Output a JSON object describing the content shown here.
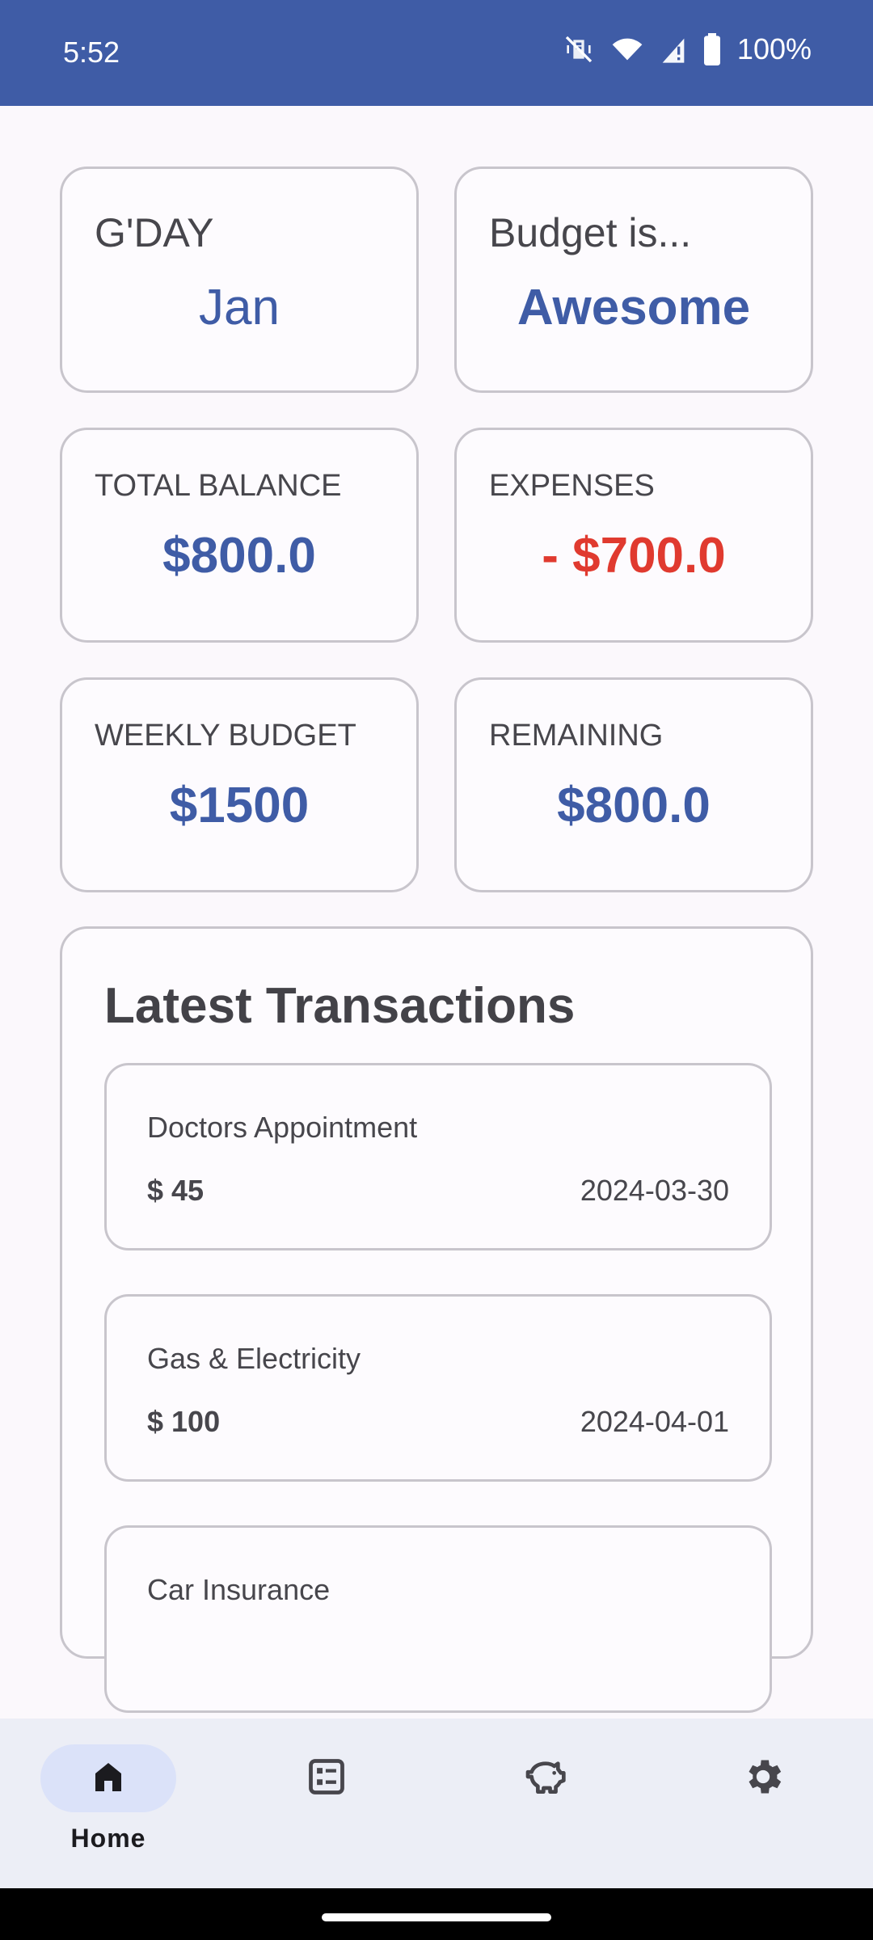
{
  "status_bar": {
    "time": "5:52",
    "battery": "100%"
  },
  "cards": {
    "greeting": {
      "label": "G'DAY",
      "value": "Jan"
    },
    "budget_status": {
      "label": "Budget is...",
      "value": "Awesome"
    },
    "total_balance": {
      "label": "TOTAL BALANCE",
      "value": "$800.0"
    },
    "expenses": {
      "label": "EXPENSES",
      "value": "- $700.0"
    },
    "weekly_budget": {
      "label": "WEEKLY BUDGET",
      "value": "$1500"
    },
    "remaining": {
      "label": "REMAINING",
      "value": "$800.0"
    }
  },
  "transactions": {
    "title": "Latest Transactions",
    "items": [
      {
        "name": "Doctors Appointment",
        "amount": "$ 45",
        "date": "2024-03-30"
      },
      {
        "name": "Gas & Electricity",
        "amount": "$ 100",
        "date": "2024-04-01"
      },
      {
        "name": "Car Insurance",
        "amount": "",
        "date": ""
      }
    ]
  },
  "bottom_nav": {
    "items": [
      {
        "label": "Home",
        "icon": "home-icon",
        "active": true
      },
      {
        "label": "",
        "icon": "list-icon",
        "active": false
      },
      {
        "label": "",
        "icon": "piggy-bank-icon",
        "active": false
      },
      {
        "label": "",
        "icon": "settings-icon",
        "active": false
      }
    ]
  },
  "colors": {
    "primary": "#3f5ca6",
    "expense": "#e03a2f",
    "nav_active": "#dbe2f9"
  }
}
